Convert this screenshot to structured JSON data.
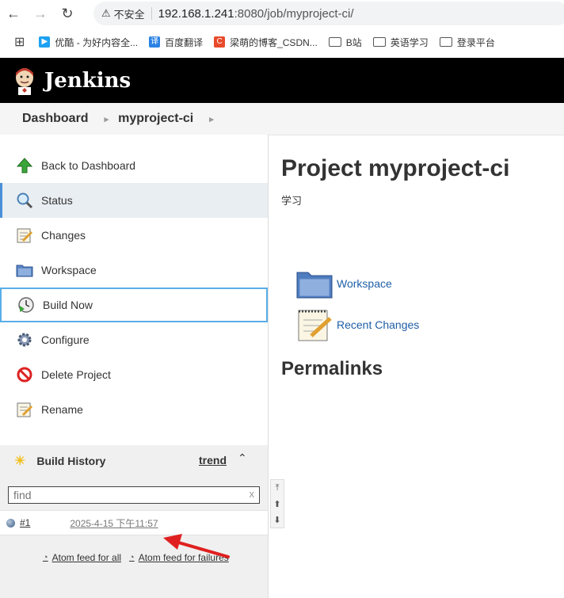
{
  "browser": {
    "insecure_label": "不安全",
    "url_host": "192.168.1.241",
    "url_path": ":8080/job/myproject-ci/"
  },
  "bookmarks": [
    {
      "label": "优酷 - 为好内容全...",
      "icon": "youku-icon",
      "color": "#1da1f2"
    },
    {
      "label": "百度翻译",
      "icon": "baidu-translate-icon",
      "color": "#2a82e4"
    },
    {
      "label": "梁萌的博客_CSDN...",
      "icon": "csdn-icon",
      "color": "#e84a2a"
    },
    {
      "label": "B站",
      "icon": "folder-icon"
    },
    {
      "label": "英语学习",
      "icon": "folder-icon"
    },
    {
      "label": "登录平台",
      "icon": "folder-icon"
    }
  ],
  "header": {
    "brand": "Jenkins"
  },
  "breadcrumb": {
    "items": [
      "Dashboard",
      "myproject-ci"
    ]
  },
  "sidebar": {
    "items": [
      {
        "label": "Back to Dashboard",
        "icon": "up-arrow-icon"
      },
      {
        "label": "Status",
        "icon": "magnifier-icon"
      },
      {
        "label": "Changes",
        "icon": "notepad-icon"
      },
      {
        "label": "Workspace",
        "icon": "folder-icon"
      },
      {
        "label": "Build Now",
        "icon": "clock-play-icon"
      },
      {
        "label": "Configure",
        "icon": "gear-icon"
      },
      {
        "label": "Delete Project",
        "icon": "no-entry-icon"
      },
      {
        "label": "Rename",
        "icon": "notepad-pencil-icon"
      }
    ]
  },
  "build_history": {
    "title": "Build History",
    "trend_label": "trend",
    "find_placeholder": "find",
    "builds": [
      {
        "number": "#1",
        "time": "2025-4-15 下午11:57"
      }
    ],
    "feed_all": "Atom feed for all",
    "feed_failures": "Atom feed for failures"
  },
  "main": {
    "title": "Project myproject-ci",
    "description": "学习",
    "links": [
      {
        "label": "Workspace",
        "icon": "folder-icon"
      },
      {
        "label": "Recent Changes",
        "icon": "notepad-pencil-icon"
      }
    ],
    "permalinks_title": "Permalinks"
  },
  "colors": {
    "header_bg": "#000000",
    "link": "#1f5fa6",
    "active_border": "#4a90d9",
    "focus_border": "#5aaee8",
    "annotation_arrow": "#e02020"
  }
}
